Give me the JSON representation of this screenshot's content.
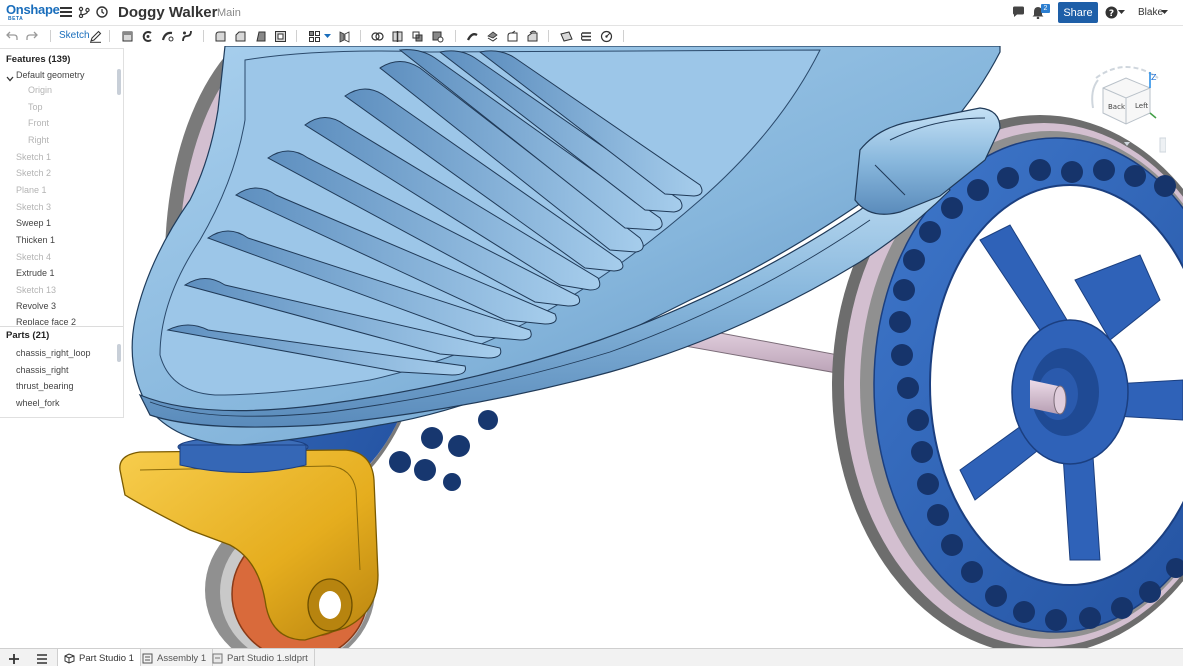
{
  "app": {
    "logo": "Onshape",
    "logo_badge": "BETA"
  },
  "document": {
    "title": "Doggy Walker",
    "branch": "Main"
  },
  "header": {
    "notifications_count": "2",
    "share_label": "Share",
    "user": "Blake"
  },
  "toolbar": {
    "sketch_label": "Sketch"
  },
  "features": {
    "header": "Features (139)",
    "group_label": "Default geometry",
    "default_items": [
      "Origin",
      "Top",
      "Front",
      "Right"
    ],
    "items": [
      {
        "label": "Sketch 1",
        "dim": true
      },
      {
        "label": "Sketch 2",
        "dim": true
      },
      {
        "label": "Plane 1",
        "dim": true
      },
      {
        "label": "Sketch 3",
        "dim": true
      },
      {
        "label": "Sweep 1",
        "dim": false
      },
      {
        "label": "Thicken 1",
        "dim": false
      },
      {
        "label": "Sketch 4",
        "dim": true
      },
      {
        "label": "Extrude 1",
        "dim": false
      },
      {
        "label": "Sketch 13",
        "dim": true
      },
      {
        "label": "Revolve 3",
        "dim": false
      },
      {
        "label": "Replace face 2",
        "dim": false
      }
    ]
  },
  "parts": {
    "header": "Parts (21)",
    "items": [
      "chassis_right_loop",
      "chassis_right",
      "thrust_bearing",
      "wheel_fork"
    ]
  },
  "view_cube": {
    "back": "Back",
    "left": "Left",
    "axis": "Z"
  },
  "tabs": [
    {
      "label": "Part Studio 1",
      "active": true
    },
    {
      "label": "Assembly 1",
      "active": false
    },
    {
      "label": "Part Studio 1.sldprt",
      "active": false
    }
  ],
  "colors": {
    "accent": "#1e5fa8",
    "body_blue": "#8bb8dc",
    "wheel_blue": "#2f62b8",
    "fork_gold": "#e5b020",
    "axle_pink": "#d6bfd2"
  }
}
